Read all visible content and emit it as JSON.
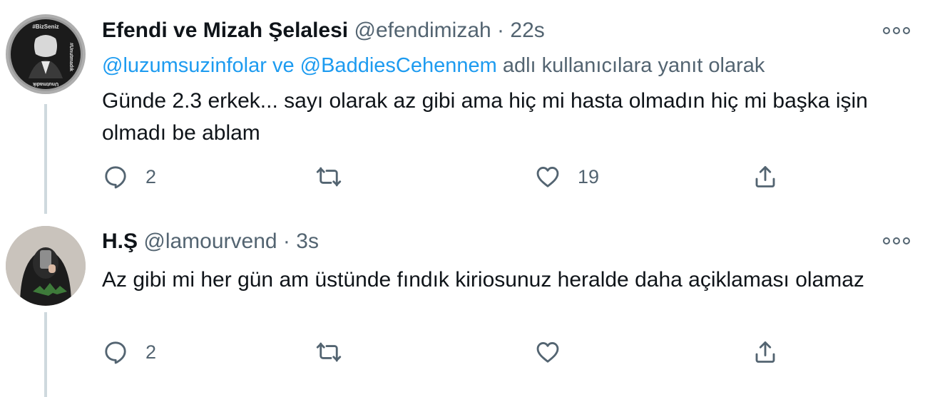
{
  "tweets": [
    {
      "name": "Efendi ve Mizah Şelalesi",
      "handle": "@efendimizah",
      "separator": "·",
      "time": "22s",
      "replying_mentions": "@luzumsuzinfolar ve @BaddiesCehennem",
      "replying_suffix": "adlı kullanıcılara yanıt olarak",
      "text": "Günde 2.3 erkek... sayı olarak az gibi ama hiç mi hasta olmadın hiç mi başka işin olmadı be ablam",
      "avatar_text_top": "#BizSeniz",
      "avatar_text_side": "#Unutmadık",
      "avatar_text_bottom": "Unutmadık",
      "reply_count": "2",
      "retweet_count": "",
      "like_count": "19"
    },
    {
      "name": "H.Ş",
      "handle": "@lamourvend",
      "separator": "·",
      "time": "3s",
      "text": "Az gibi mi her gün am üstünde fındık kiriosunuz heralde daha açiklaması olamaz",
      "reply_count": "2",
      "retweet_count": "",
      "like_count": ""
    }
  ],
  "colors": {
    "text": "#0f1419",
    "secondary": "#536471",
    "link": "#1d9bf0",
    "thread_line": "#cfd9de"
  },
  "icons": [
    "more-icon",
    "reply-icon",
    "retweet-icon",
    "like-icon",
    "share-icon"
  ]
}
